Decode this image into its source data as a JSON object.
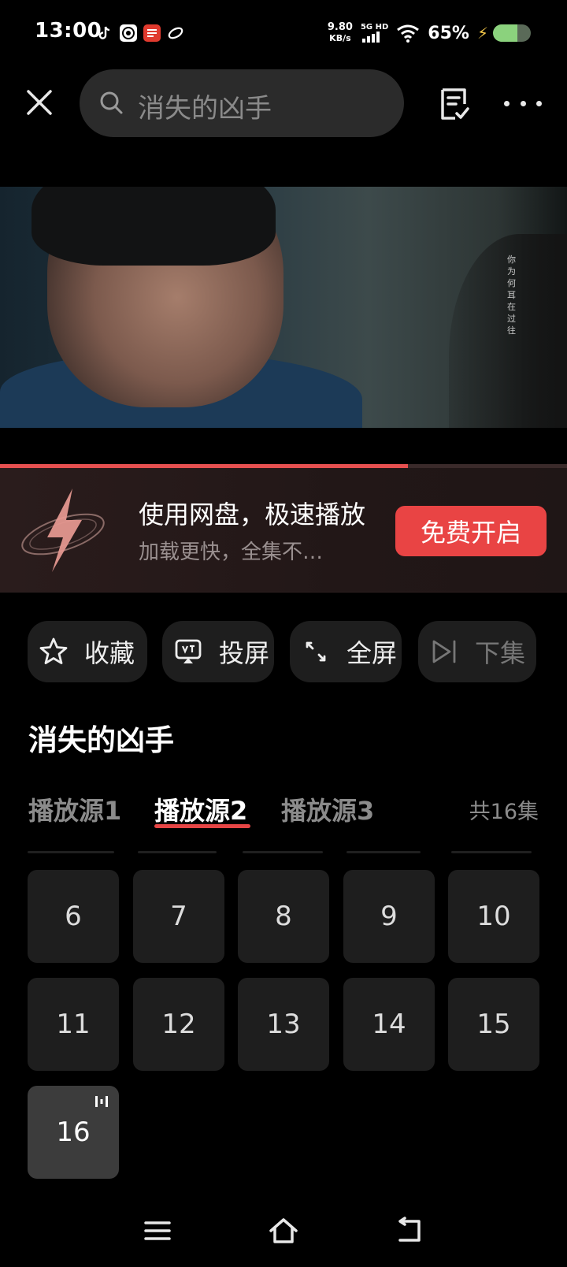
{
  "status_bar": {
    "time": "13:00",
    "net_speed_value": "9.80",
    "net_speed_unit": "KB/s",
    "signal_label": "5G HD",
    "battery_percent": "65%",
    "battery_level": 0.65,
    "battery_color": "#8bd27d",
    "app_icons": [
      "tiktok-icon",
      "app-icon",
      "news-app-icon",
      "link-app-icon"
    ]
  },
  "header": {
    "close_icon": "close-icon",
    "search_placeholder": "消失的凶手",
    "search_icon": "search-icon",
    "list_icon": "checklist-icon",
    "more_icon": "more-icon"
  },
  "video": {
    "overlay_text": "你为何耳在过往",
    "progress": 0.72,
    "accent": "#e65050"
  },
  "promo": {
    "title": "使用网盘，极速播放",
    "subtitle": "加载更快，全集不…",
    "button": "免费开启",
    "button_color": "#e94444",
    "icon": "lightning-icon"
  },
  "actions": [
    {
      "label": "收藏",
      "icon": "star-icon"
    },
    {
      "label": "投屏",
      "icon": "cast-icon"
    },
    {
      "label": "全屏",
      "icon": "fullscreen-icon"
    },
    {
      "label": "下集",
      "icon": "next-episode-icon"
    }
  ],
  "show": {
    "title": "消失的凶手"
  },
  "sources": {
    "tabs": [
      "播放源1",
      "播放源2",
      "播放源3"
    ],
    "active_index": 1,
    "total": "共16集"
  },
  "episodes": {
    "items": [
      "6",
      "7",
      "8",
      "9",
      "10",
      "11",
      "12",
      "13",
      "14",
      "15",
      "16"
    ],
    "current": "16",
    "playing_icon": "playing-bars-icon"
  },
  "nav": {
    "icons": [
      "menu-icon",
      "home-icon",
      "back-icon"
    ]
  }
}
